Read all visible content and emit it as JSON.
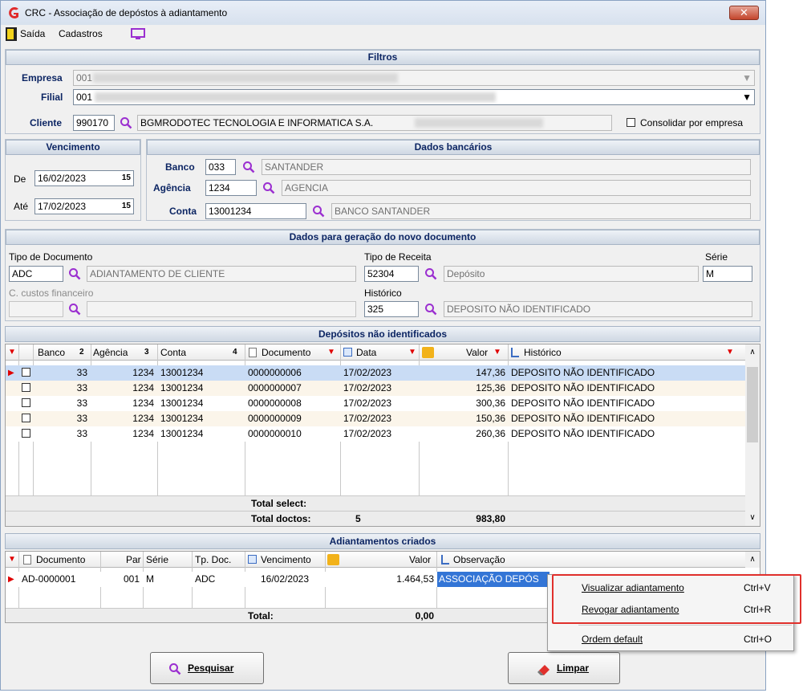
{
  "window": {
    "title": "CRC - Associação de depóstos à adiantamento",
    "close": "✕"
  },
  "menu": {
    "exit": "Saída",
    "registrations": "Cadastros"
  },
  "filters": {
    "header": "Filtros",
    "company_label": "Empresa",
    "company_value": "001",
    "branch_label": "Filial",
    "branch_value": "001",
    "client_label": "Cliente",
    "client_code": "990170",
    "client_name": "BGMRODOTEC TECNOLOGIA E INFORMATICA S.A.",
    "consolidate_label": "Consolidar por empresa"
  },
  "due": {
    "header": "Vencimento",
    "from_label": "De",
    "from_value": "16/02/2023",
    "to_label": "Até",
    "to_value": "17/02/2023"
  },
  "bank": {
    "header": "Dados bancários",
    "bank_label": "Banco",
    "bank_code": "033",
    "bank_name": "SANTANDER",
    "agency_label": "Agência",
    "agency_code": "1234",
    "agency_name": "AGENCIA",
    "account_label": "Conta",
    "account_code": "13001234",
    "account_name": "BANCO SANTANDER"
  },
  "newdoc": {
    "header": "Dados para geração do novo documento",
    "doctype_label": "Tipo de Documento",
    "doctype_code": "ADC",
    "doctype_name": "ADIANTAMENTO DE CLIENTE",
    "revtype_label": "Tipo de Receita",
    "revtype_code": "52304",
    "revtype_name": "Depósito",
    "series_label": "Série",
    "series_value": "M",
    "costcenter_label": "C. custos financeiro",
    "history_label": "Histórico",
    "history_code": "325",
    "history_name": "DEPOSITO NÃO IDENTIFICADO"
  },
  "deposits": {
    "header": "Depósitos não identificados",
    "columns": {
      "bank": "Banco",
      "bank_sort": "2",
      "agency": "Agência",
      "agency_sort": "3",
      "account": "Conta",
      "account_sort": "4",
      "document": "Documento",
      "date": "Data",
      "value": "Valor",
      "history": "Histórico"
    },
    "rows": [
      {
        "bank": "33",
        "agency": "1234",
        "account": "13001234",
        "document": "0000000006",
        "date": "17/02/2023",
        "value": "147,36",
        "history": "DEPOSITO NÃO IDENTIFICADO"
      },
      {
        "bank": "33",
        "agency": "1234",
        "account": "13001234",
        "document": "0000000007",
        "date": "17/02/2023",
        "value": "125,36",
        "history": "DEPOSITO NÃO IDENTIFICADO"
      },
      {
        "bank": "33",
        "agency": "1234",
        "account": "13001234",
        "document": "0000000008",
        "date": "17/02/2023",
        "value": "300,36",
        "history": "DEPOSITO NÃO IDENTIFICADO"
      },
      {
        "bank": "33",
        "agency": "1234",
        "account": "13001234",
        "document": "0000000009",
        "date": "17/02/2023",
        "value": "150,36",
        "history": "DEPOSITO NÃO IDENTIFICADO"
      },
      {
        "bank": "33",
        "agency": "1234",
        "account": "13001234",
        "document": "0000000010",
        "date": "17/02/2023",
        "value": "260,36",
        "history": "DEPOSITO NÃO IDENTIFICADO"
      }
    ],
    "total_select_label": "Total select:",
    "total_docs_label": "Total doctos:",
    "total_docs_count": "5",
    "total_docs_value": "983,80"
  },
  "advances": {
    "header": "Adiantamentos criados",
    "columns": {
      "document": "Documento",
      "par": "Par",
      "series": "Série",
      "doctype": "Tp. Doc.",
      "due": "Vencimento",
      "value": "Valor",
      "obs": "Observação"
    },
    "rows": [
      {
        "document": "AD-0000001",
        "par": "001",
        "series": "M",
        "doctype": "ADC",
        "due": "16/02/2023",
        "value": "1.464,53",
        "obs": "ASSOCIAÇÃO DEPÓS"
      }
    ],
    "total_label": "Total:",
    "total_value": "0,00"
  },
  "buttons": {
    "search": "Pesquisar",
    "clear": "Limpar"
  },
  "context_menu": {
    "items": [
      {
        "label": "Visualizar adiantamento",
        "shortcut": "Ctrl+V"
      },
      {
        "label": "Revogar adiantamento",
        "shortcut": "Ctrl+R"
      },
      {
        "label": "Ordem default",
        "shortcut": "Ctrl+O"
      }
    ]
  },
  "colors": {
    "highlight_border": "#e0302c",
    "header_text": "#0c2563",
    "selected_row": "#c9dcf5"
  }
}
